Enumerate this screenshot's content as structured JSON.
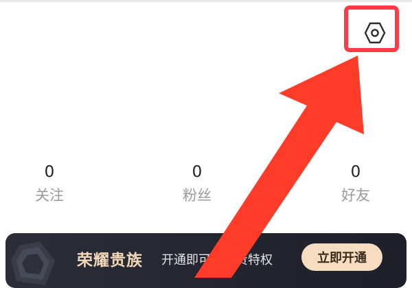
{
  "header": {
    "settings_icon": "hexagon-settings-icon"
  },
  "stats": [
    {
      "value": "0",
      "label": "关注"
    },
    {
      "value": "0",
      "label": "粉丝"
    },
    {
      "value": "0",
      "label": "好友"
    }
  ],
  "vip_banner": {
    "title": "荣耀贵族",
    "description": "开通即可享尊贵特权",
    "button_label": "立即开通"
  },
  "annotation": {
    "highlight_color": "#ff3b45",
    "arrow_color": "#ff3b2a"
  }
}
